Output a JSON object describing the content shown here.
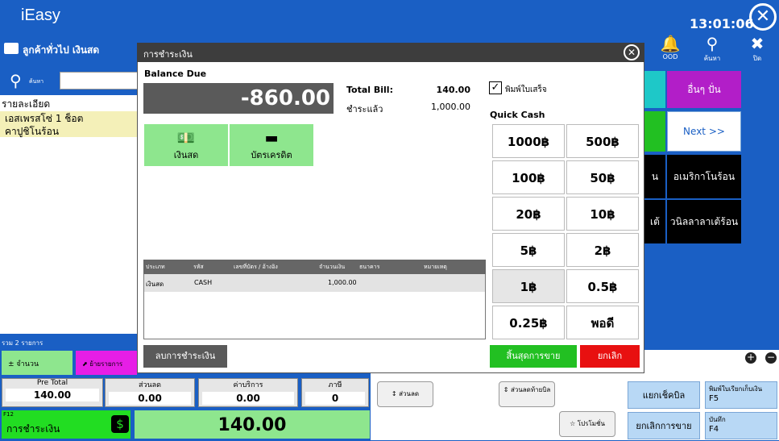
{
  "header": {
    "logo": "iEasy",
    "clock": "13:01:06",
    "customer": "ลูกค้าทั่วไป เงินสด",
    "icon_labels": {
      "ood": "OOD",
      "search": "ค้นหา",
      "close": "ปิด"
    }
  },
  "search": {
    "label": "ค้นหา"
  },
  "order_list": {
    "header": "รายละเอียด",
    "items": [
      "เอสเพรสโซ่ 1 ช็อต",
      "คาปูชิโนร้อน"
    ],
    "summary": "รวม 2 รายการ"
  },
  "actions": {
    "qty": "จำนวน",
    "move": "ย้ายรายการ"
  },
  "totals": {
    "pre_total_label": "Pre Total",
    "pre_total": "140.00",
    "discount_label": "ส่วนลด",
    "discount": "0.00",
    "service_label": "ค่าบริการ",
    "service": "0.00",
    "tax_label": "ภาษี",
    "tax": "0"
  },
  "payment_button": {
    "key": "F12",
    "label": "การชำระเงิน",
    "icon": "dollar-icon"
  },
  "grand_total": "140.00",
  "menu_right": {
    "other": "อื่นๆ ปั่น",
    "next": "Next >>",
    "americano_hot": "อเมริกาโนร้อน",
    "vanilla_latte_hot": "วนิลลาลาเต้ร้อน",
    "partial1": "น",
    "partial2": "เต้"
  },
  "bottom_tools": {
    "discount": "ส่วนลด",
    "end_discount": "ส่วนลดท้ายบิล",
    "promo": "โปรโมชั่น",
    "split_bill": "แยกเช็คบิล",
    "print_bill": "พิมพ์ใบเรียกเก็บเงิน",
    "print_key": "F5",
    "cancel_sale": "ยกเลิกการขาย",
    "save": "บันทึก",
    "save_key": "F4"
  },
  "colors": {
    "primary": "#1a5fc4",
    "green": "#8ee68e",
    "magenta": "#e61ee6",
    "purple": "#b21ec8",
    "teal": "#1ec8c8",
    "red": "#e81010"
  },
  "modal": {
    "title": "การชำระเงิน",
    "balance_due_label": "Balance Due",
    "balance_due": "-860.00",
    "total_bill_label": "Total Bill:",
    "total_bill": "140.00",
    "paid_label": "ชำระแล้ว",
    "paid": "1,000.00",
    "print_receipt": "พิมพ์ใบเสร็จ",
    "print_receipt_checked": true,
    "quick_cash_label": "Quick Cash",
    "methods": [
      {
        "label": "เงินสด",
        "icon": "cash-hand-icon"
      },
      {
        "label": "บัตรเครดิต",
        "icon": "credit-card-icon"
      }
    ],
    "quick_cash": [
      "1000฿",
      "500฿",
      "100฿",
      "50฿",
      "20฿",
      "10฿",
      "5฿",
      "2฿",
      "1฿",
      "0.5฿",
      "0.25฿",
      "พอดี"
    ],
    "table": {
      "columns": [
        "ประเภท",
        "รหัส",
        "เลขที่บัตร / อ้างอิง",
        "จำนวนเงิน",
        "ธนาคาร",
        "หมายเหตุ"
      ],
      "rows": [
        [
          "เงินสด",
          "CASH",
          "",
          "1,000.00",
          "",
          ""
        ]
      ]
    },
    "cancel_payment": "ลบการชำระเงิน",
    "finish": "สิ้นสุดการขาย",
    "cancel": "ยกเลิก"
  }
}
